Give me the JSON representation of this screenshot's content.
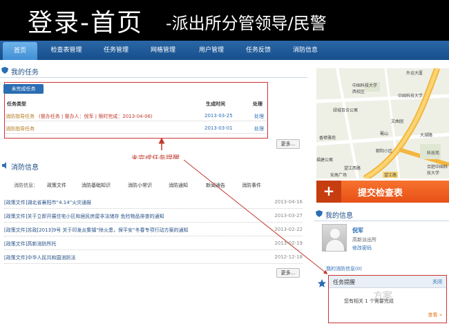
{
  "slide": {
    "title": "登录-首页",
    "subtitle": "-派出所分管领导/民警"
  },
  "nav": {
    "items": [
      {
        "label": "首页",
        "active": true
      },
      {
        "label": "检查表管理"
      },
      {
        "label": "任务管理"
      },
      {
        "label": "网格管理"
      },
      {
        "label": "用户管理"
      },
      {
        "label": "任务反馈"
      },
      {
        "label": "消防信息"
      }
    ]
  },
  "tasks": {
    "title": "我的任务",
    "filter_button": "未完成任务",
    "headers": {
      "type": "任务类型",
      "time": "生成时间",
      "action": "处理"
    },
    "rows": [
      {
        "type": "消防指导任务",
        "meta": "(督办任务 | 督办人：倪军 | 限时完成：2013-04-06)",
        "time": "2013-03-25",
        "action": "处理"
      },
      {
        "type": "消防指导任务",
        "meta": "",
        "time": "2013-03-01",
        "action": "处理"
      }
    ],
    "more": "更多..."
  },
  "callout": "未完成任务提醒",
  "fire_info": {
    "title": "消防信息",
    "tabs": [
      "消防信息：",
      "政策文件",
      "消防基础知识",
      "消防小常识",
      "消防通知",
      "新闻通告",
      "消防事件"
    ],
    "rows": [
      {
        "title": "[政策文件]湖北省襄阳市“4.14”火灾通报",
        "date": "2013-04-16"
      },
      {
        "title": "[政策文件]关于立即开展住宅小区和居民房屋非法储存 危险物品排查的通知",
        "date": "2013-03-27"
      },
      {
        "title": "[政策文件]苏政[2013]9号 关于印发炎集镇“除火患，保平安”冬春专项行动方案的通知",
        "date": "2013-02-22"
      },
      {
        "title": "[政策文件]高新消防所托",
        "date": "2013-02-19"
      },
      {
        "title": "[政策文件]中华人民共和国消防法",
        "date": "2012-12-18"
      }
    ],
    "more": "更多..."
  },
  "map": {
    "labels": [
      "外运大厦",
      "中国科技大学西校区",
      "中国科技大学",
      "绿城百合公寓",
      "文曲园",
      "蜀山",
      "香樟雅苑",
      "朝阳小区",
      "科技苑",
      "合肥中国科技大学",
      "福建公寓",
      "望江西路",
      "安高广场",
      "望江路",
      "大湖路"
    ]
  },
  "submit": {
    "label": "提交检查表",
    "icon": "plus-icon"
  },
  "my_info": {
    "title": "我的信息",
    "name": "倪军",
    "org": "高新派出所",
    "edit": "修改密码",
    "messages": "我的消防信息(0)"
  },
  "popup": {
    "title": "任务提醒",
    "close": "关闭",
    "body": "您有相关 1 个需要完成",
    "view": "查看 »"
  },
  "watermark": "方案",
  "colors": {
    "nav": "#1d5996",
    "accent": "#c0392b",
    "submit": "#ec5a1e"
  }
}
